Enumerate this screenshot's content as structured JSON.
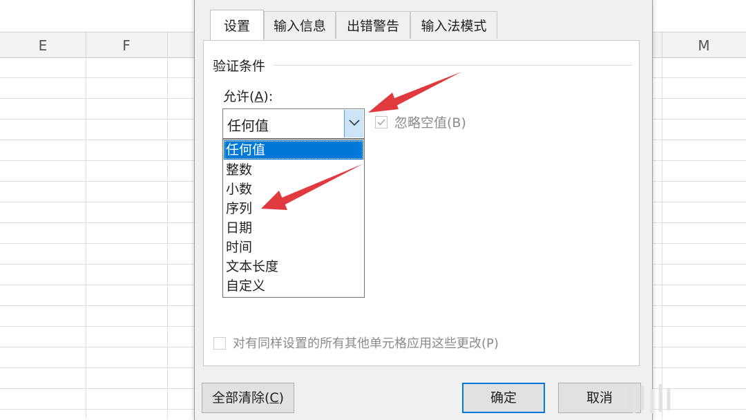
{
  "sheet": {
    "columns": [
      {
        "label": "E"
      },
      {
        "label": "F"
      },
      {
        "label": "M"
      }
    ]
  },
  "dialog": {
    "tabs": [
      {
        "label": "设置",
        "active": true
      },
      {
        "label": "输入信息",
        "active": false
      },
      {
        "label": "出错警告",
        "active": false
      },
      {
        "label": "输入法模式",
        "active": false
      }
    ],
    "group_title": "验证条件",
    "allow_label": "允许(",
    "allow_accel": "A",
    "allow_label_end": "):",
    "allow_value": "任何值",
    "ignore_blank_label": "忽略空值(B)",
    "ignore_blank_checked": true,
    "ignore_blank_enabled": false,
    "options": [
      {
        "label": "任何值",
        "selected": true
      },
      {
        "label": "整数",
        "selected": false
      },
      {
        "label": "小数",
        "selected": false
      },
      {
        "label": "序列",
        "selected": false
      },
      {
        "label": "日期",
        "selected": false
      },
      {
        "label": "时间",
        "selected": false
      },
      {
        "label": "文本长度",
        "selected": false
      },
      {
        "label": "自定义",
        "selected": false
      }
    ],
    "apply_all_label": "对有同样设置的所有其他单元格应用这些更改(P)",
    "apply_all_checked": false,
    "buttons": {
      "clear_all": "全部清除(",
      "clear_accel": "C",
      "clear_end": ")",
      "ok": "确定",
      "cancel": "取消"
    }
  },
  "colors": {
    "selection": "#0078d7",
    "combo_button": "#cce4f7",
    "arrow": "#e0393e",
    "disabled_text": "#8a8a8a"
  },
  "icons": [
    "chevron-down-icon",
    "check-icon",
    "annotation-arrow"
  ]
}
